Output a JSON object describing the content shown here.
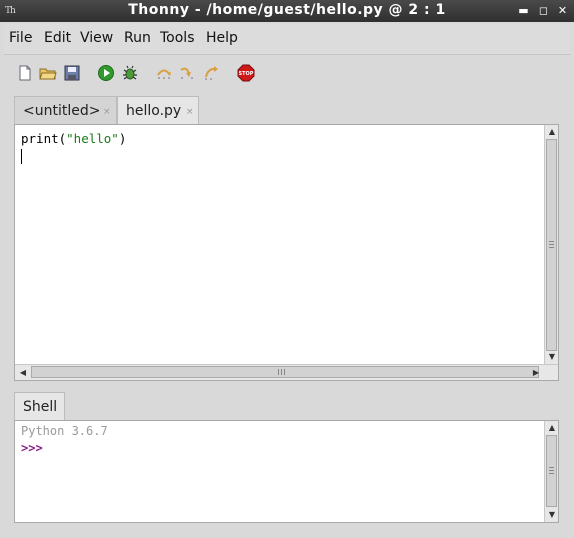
{
  "window": {
    "title": "Thonny  -  /home/guest/hello.py  @  2 : 1",
    "app_icon_text": "Th",
    "controls": {
      "minimize": "▬",
      "maximize": "◻",
      "close": "✕"
    }
  },
  "menu": {
    "items": [
      {
        "label": "File"
      },
      {
        "label": "Edit"
      },
      {
        "label": "View"
      },
      {
        "label": "Run"
      },
      {
        "label": "Tools"
      },
      {
        "label": "Help"
      }
    ]
  },
  "toolbar": {
    "buttons": [
      {
        "icon": "new-file-icon"
      },
      {
        "icon": "open-folder-icon"
      },
      {
        "icon": "save-icon"
      },
      {
        "icon": "run-icon"
      },
      {
        "icon": "debug-icon"
      },
      {
        "icon": "step-over-icon"
      },
      {
        "icon": "step-into-icon"
      },
      {
        "icon": "step-out-icon"
      },
      {
        "icon": "stop-icon",
        "label": "STOP"
      }
    ],
    "colors": {
      "run": "#2f9a2f",
      "stop": "#d01818",
      "step": "#d8a042"
    }
  },
  "editor": {
    "tabs": [
      {
        "label": "<untitled>",
        "close": "×"
      },
      {
        "label": "hello.py",
        "close": "×",
        "active": true
      }
    ],
    "code": {
      "func": "print(",
      "string": "\"hello\"",
      "close": ")"
    }
  },
  "shell": {
    "tab_label": "Shell",
    "version": "Python 3.6.7",
    "prompt": ">>>"
  }
}
